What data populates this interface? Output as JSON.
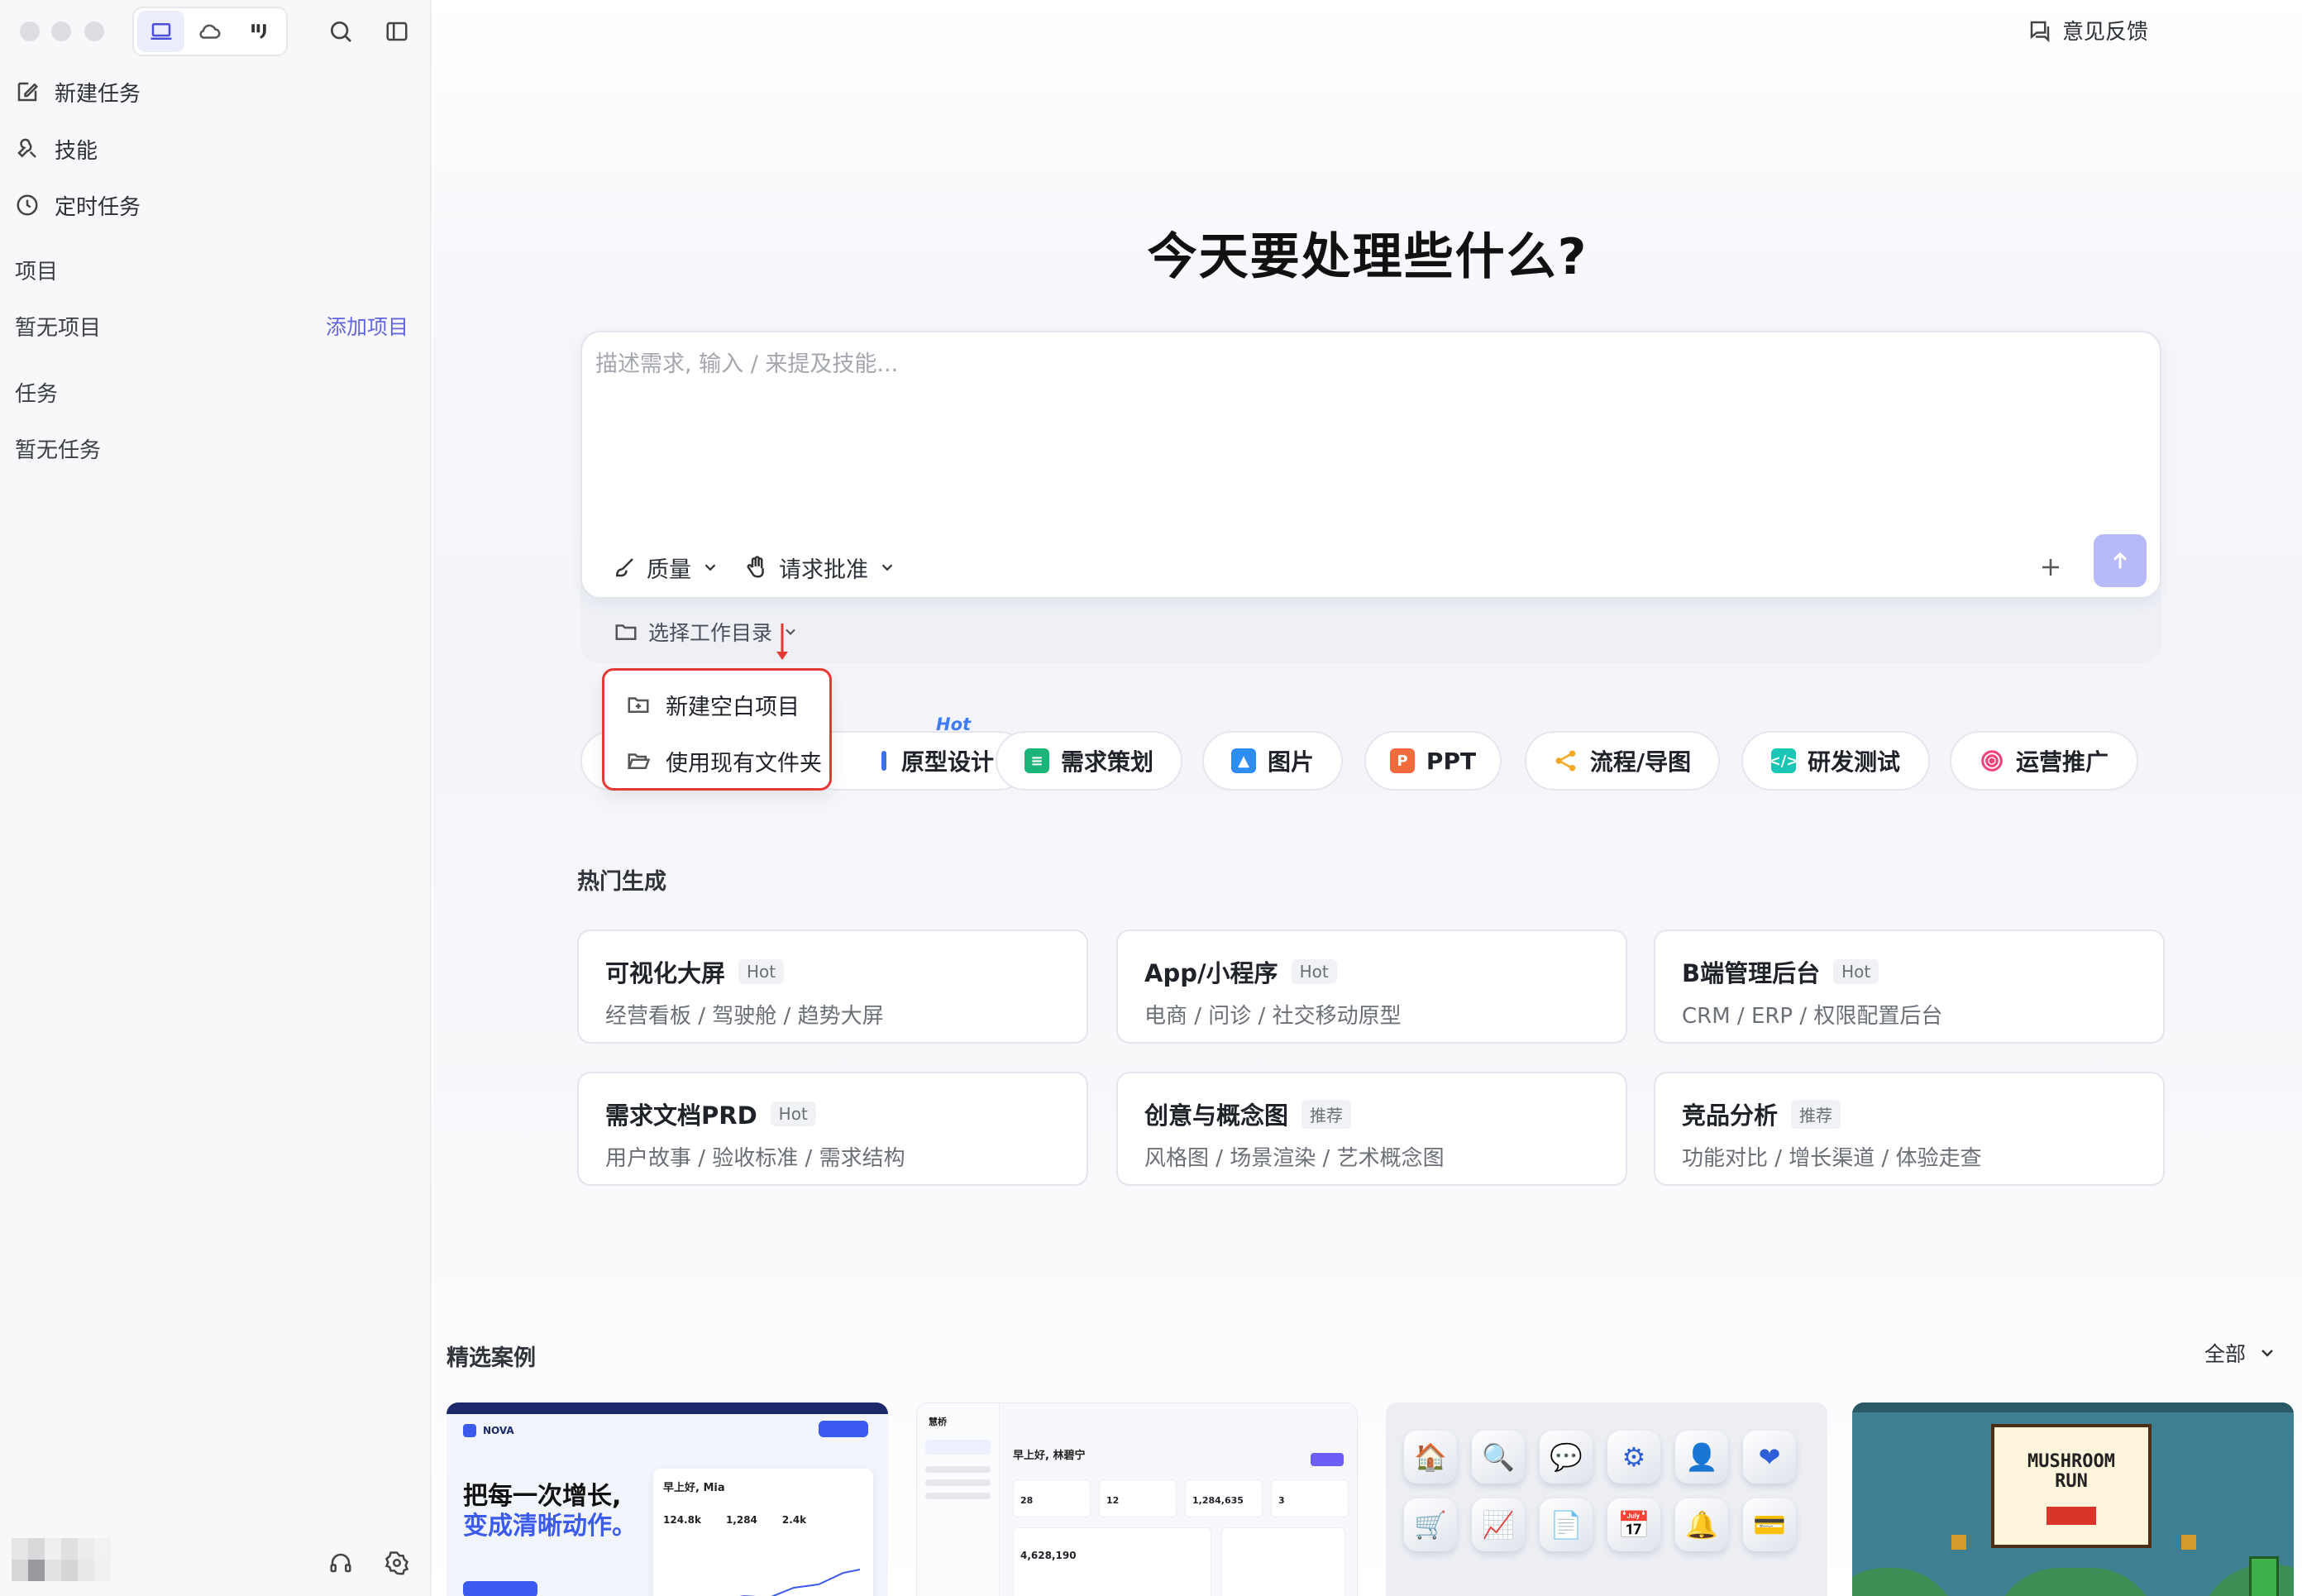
{
  "sidebar": {
    "nav": [
      {
        "label": "新建任务",
        "icon": "edit-icon"
      },
      {
        "label": "技能",
        "icon": "tools-icon"
      },
      {
        "label": "定时任务",
        "icon": "clock-icon"
      }
    ],
    "projects_label": "项目",
    "projects_empty": "暂无项目",
    "add_project": "添加项目",
    "tasks_label": "任务",
    "tasks_empty": "暂无任务"
  },
  "header": {
    "feedback": "意见反馈"
  },
  "main": {
    "headline": "今天要处理些什么?",
    "composer": {
      "placeholder": "描述需求, 输入 / 来提及技能...",
      "quality_label": "质量",
      "approval_label": "请求批准",
      "workdir_label": "选择工作目录"
    },
    "workdir_menu": [
      {
        "label": "新建空白项目",
        "icon": "folder-plus-icon"
      },
      {
        "label": "使用现有文件夹",
        "icon": "folder-open-icon"
      }
    ],
    "hot_flag": "Hot",
    "categories": [
      {
        "label": "原型设计",
        "color": "#3d6ff2"
      },
      {
        "label": "需求策划",
        "color": "#1db47a"
      },
      {
        "label": "图片",
        "color": "#2f8ef5"
      },
      {
        "label": "PPT",
        "color": "#f26b3d"
      },
      {
        "label": "流程/导图",
        "color": "#f5a623"
      },
      {
        "label": "研发测试",
        "color": "#1cc6b4"
      },
      {
        "label": "运营推广",
        "color": "#f0437a"
      }
    ],
    "hot_title": "热门生成",
    "hot_cards": [
      {
        "title": "可视化大屏",
        "tag": "Hot",
        "sub": "经营看板 / 驾驶舱 / 趋势大屏"
      },
      {
        "title": "App/小程序",
        "tag": "Hot",
        "sub": "电商 / 问诊 / 社交移动原型"
      },
      {
        "title": "B端管理后台",
        "tag": "Hot",
        "sub": "CRM / ERP / 权限配置后台"
      },
      {
        "title": "需求文档PRD",
        "tag": "Hot",
        "sub": "用户故事 / 验收标准 / 需求结构"
      },
      {
        "title": "创意与概念图",
        "tag": "推荐",
        "sub": "风格图 / 场景渲染 / 艺术概念图"
      },
      {
        "title": "竞品分析",
        "tag": "推荐",
        "sub": "功能对比 / 增长渠道 / 体验走查"
      }
    ],
    "featured_title": "精选案例",
    "filter_label": "全部",
    "thumbs": [
      {
        "brand": "NOVA",
        "headline1": "把每一次增长,",
        "headline2": "变成清晰动作。",
        "greeting": "早上好, Mia",
        "stats": [
          "124.8k",
          "1,284",
          "2.4k"
        ]
      },
      {
        "brand": "慧桥",
        "greeting": "早上好, 林碧宁",
        "stats": [
          "28",
          "12",
          "1,284,635",
          "3"
        ],
        "amount": "4,628,190"
      },
      {
        "icons": [
          "🏠",
          "🔍",
          "💬",
          "⚙",
          "👤",
          "❤",
          "🛒",
          "📈",
          "📄",
          "📅",
          "🔔",
          "💳"
        ]
      },
      {
        "title1": "MUSHROOM",
        "title2": "RUN"
      }
    ]
  }
}
